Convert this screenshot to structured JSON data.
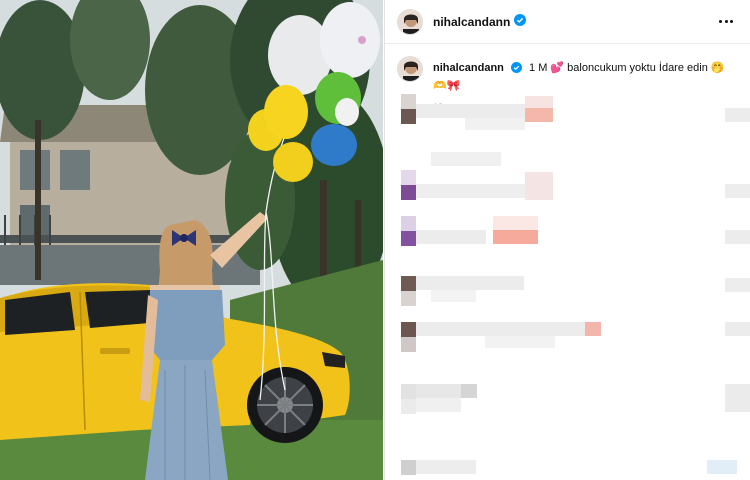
{
  "post": {
    "username": "nihalcandann",
    "verified": true,
    "caption_username": "nihalcandann",
    "caption_text": "1 M 💕 baloncukum yoktu İdare edin 🤭🫶🎀",
    "timestamp": "13s"
  },
  "icons": {
    "more": "more-horizontal-icon",
    "verified": "verified-badge-icon"
  },
  "colors": {
    "verified_blue": "#0095f6",
    "time_gray": "#8e8e8e",
    "car_yellow": "#f2c21c"
  }
}
